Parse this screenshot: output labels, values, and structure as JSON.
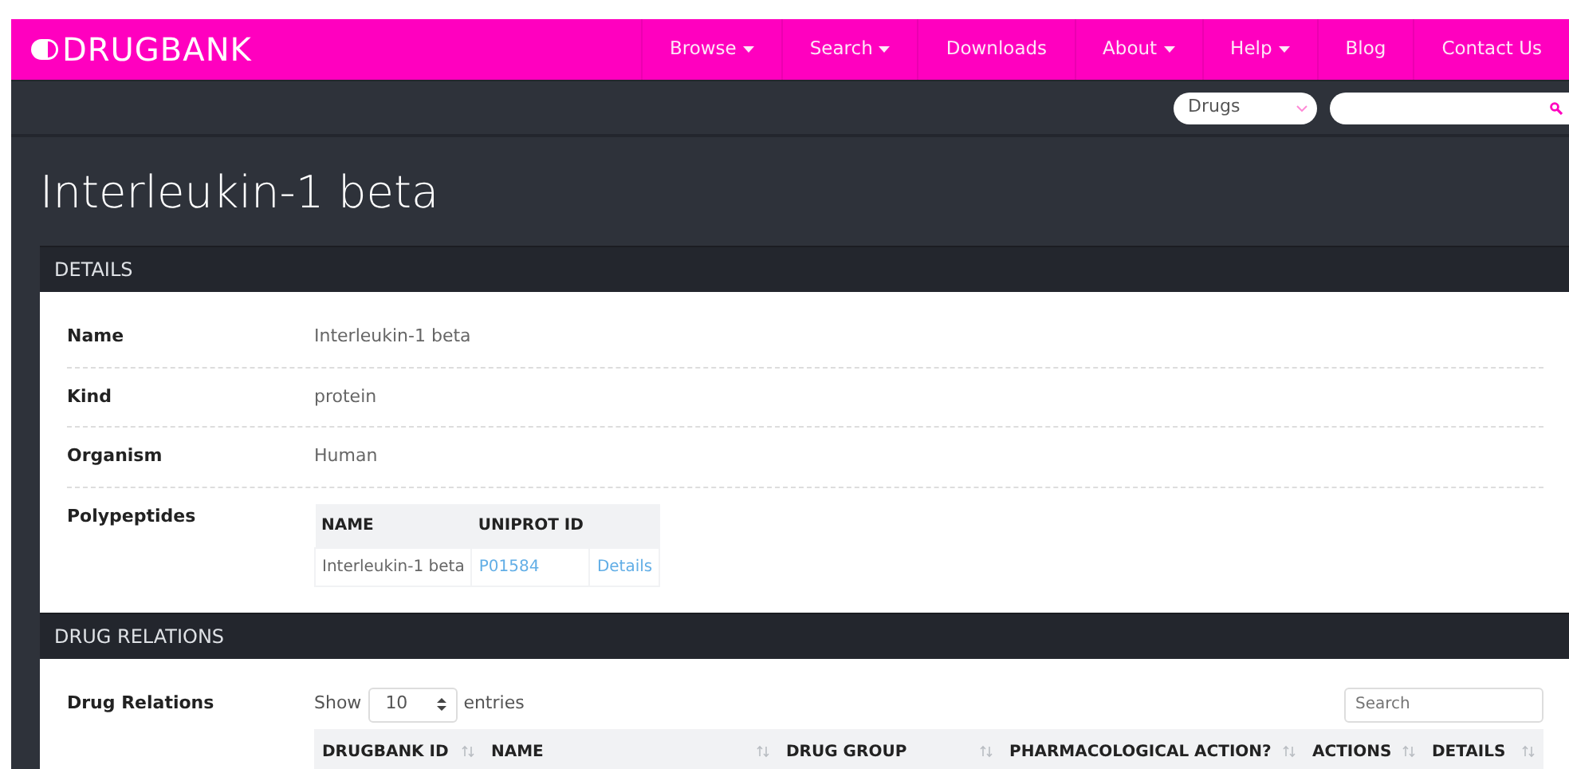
{
  "brand": "DRUGBANK",
  "nav": [
    {
      "label": "Browse",
      "dropdown": true
    },
    {
      "label": "Search",
      "dropdown": true
    },
    {
      "label": "Downloads",
      "dropdown": false
    },
    {
      "label": "About",
      "dropdown": true
    },
    {
      "label": "Help",
      "dropdown": true
    },
    {
      "label": "Blog",
      "dropdown": false
    },
    {
      "label": "Contact Us",
      "dropdown": false
    }
  ],
  "search_bar": {
    "category": "Drugs"
  },
  "page_title": "Interleukin-1 beta",
  "sections": [
    {
      "header": "DETAILS",
      "rows": [
        {
          "label": "Name",
          "kind": "text",
          "value": "Interleukin-1 beta"
        },
        {
          "label": "Kind",
          "kind": "text",
          "value": "protein"
        },
        {
          "label": "Organism",
          "kind": "text",
          "value": "Human"
        },
        {
          "label": "Polypeptides",
          "kind": "table",
          "columns": [
            "NAME",
            "UNIPROT ID"
          ],
          "rows": [
            [
              {
                "text": "Interleukin-1 beta",
                "link": false
              },
              {
                "text": "P01584",
                "link": true
              },
              {
                "text": "Details",
                "link": true
              }
            ]
          ]
        }
      ]
    },
    {
      "header": "DRUG RELATIONS",
      "rows": [
        {
          "label": "Drug Relations",
          "kind": "datatable",
          "show_label": "Show",
          "page_length": "10",
          "entries_label": "entries",
          "search_placeholder": "Search",
          "columns": [
            "DRUGBANK ID",
            "NAME",
            "DRUG GROUP",
            "PHARMACOLOGICAL ACTION?",
            "ACTIONS",
            "DETAILS"
          ]
        }
      ]
    }
  ]
}
